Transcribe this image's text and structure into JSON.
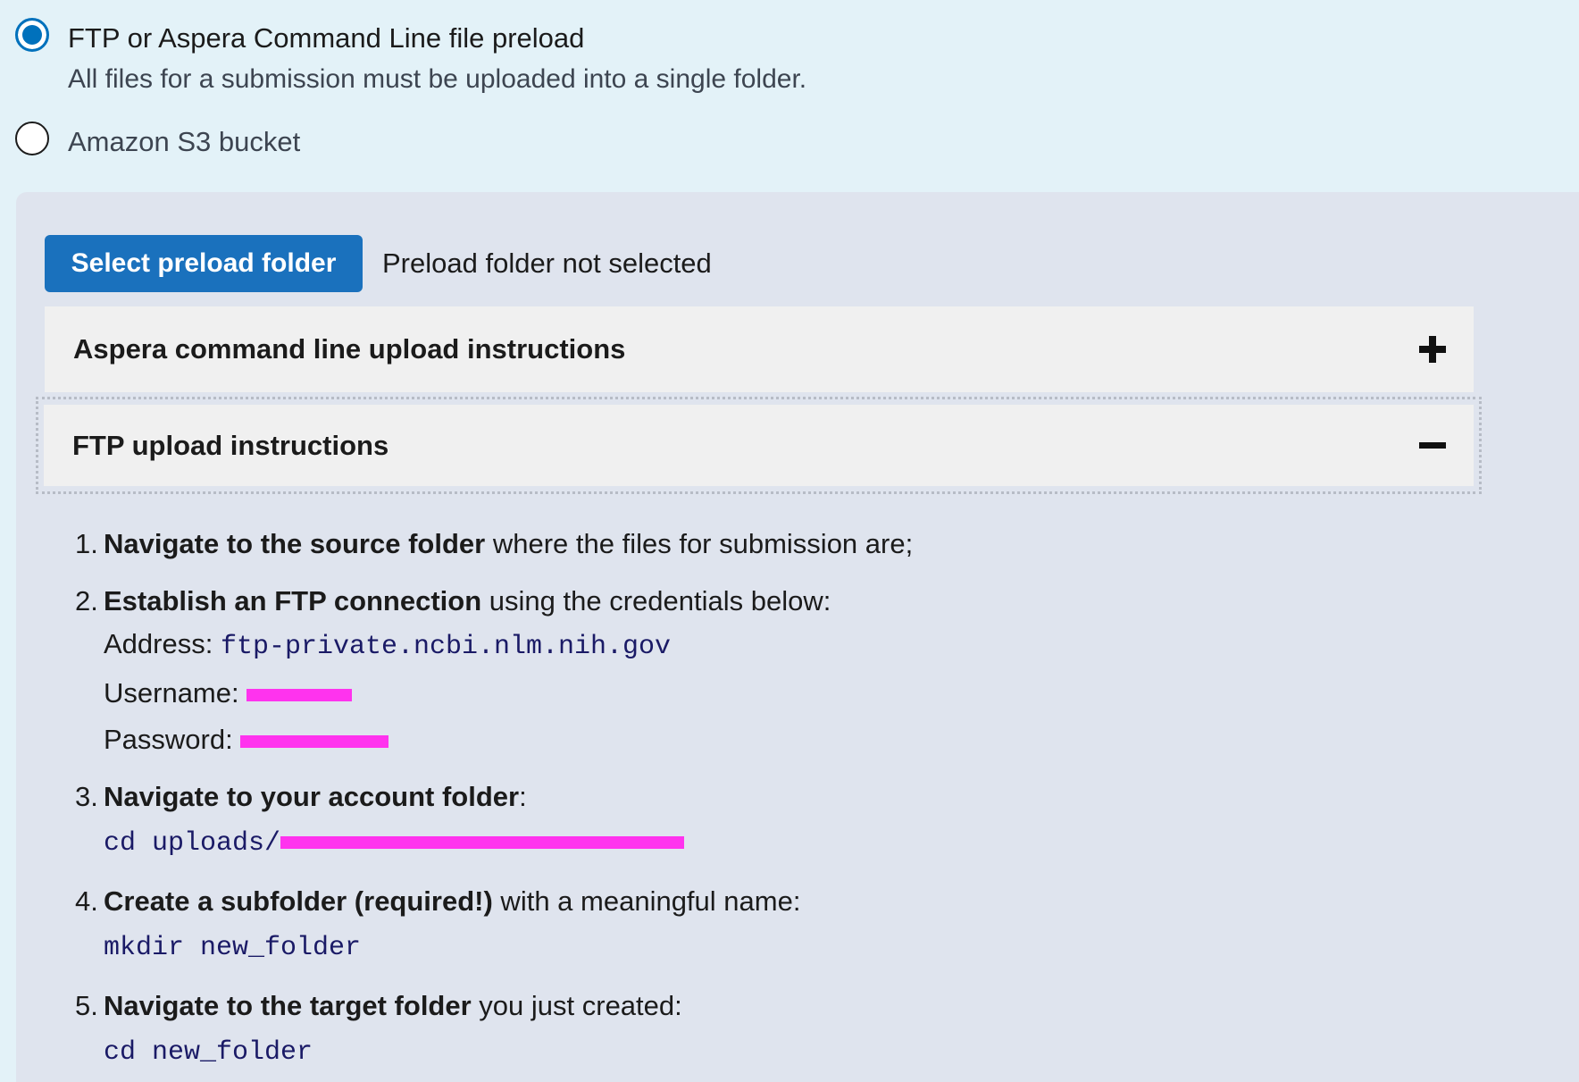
{
  "upload_method": {
    "option_ftp": {
      "label": "FTP or Aspera Command Line file preload",
      "description": "All files for a submission must be uploaded into a single folder.",
      "selected": true
    },
    "option_s3": {
      "label": "Amazon S3 bucket",
      "selected": false
    }
  },
  "panel": {
    "select_button_label": "Select preload folder",
    "folder_status": "Preload folder not selected",
    "accordions": [
      {
        "title": "Aspera command line upload instructions",
        "icon": "plus-icon",
        "expanded": false
      },
      {
        "title": "FTP upload instructions",
        "icon": "minus-icon",
        "expanded": true
      }
    ]
  },
  "instructions": {
    "step1": {
      "num": "1.",
      "bold": "Navigate to the source folder",
      "rest": " where the files for submission are;"
    },
    "step2": {
      "num": "2.",
      "bold": "Establish an FTP connection",
      "rest": " using the credentials below:",
      "address_label": "Address: ",
      "address_value": "ftp-private.ncbi.nlm.nih.gov",
      "username_label": "Username: ",
      "password_label": "Password: "
    },
    "step3": {
      "num": "3.",
      "bold": "Navigate to your account folder",
      "rest": ":",
      "code": "cd uploads/"
    },
    "step4": {
      "num": "4.",
      "bold": "Create a subfolder (required!)",
      "rest": " with a meaningful name:",
      "code": "mkdir new_folder"
    },
    "step5": {
      "num": "5.",
      "bold": "Navigate to the target folder",
      "rest": " you just created:",
      "code": "cd new_folder"
    }
  },
  "colors": {
    "page_bg": "#e3f2f8",
    "panel_bg": "#dfe4ee",
    "primary": "#1a71bd",
    "code_text": "#1a1a66",
    "redaction": "#ff33ee"
  }
}
